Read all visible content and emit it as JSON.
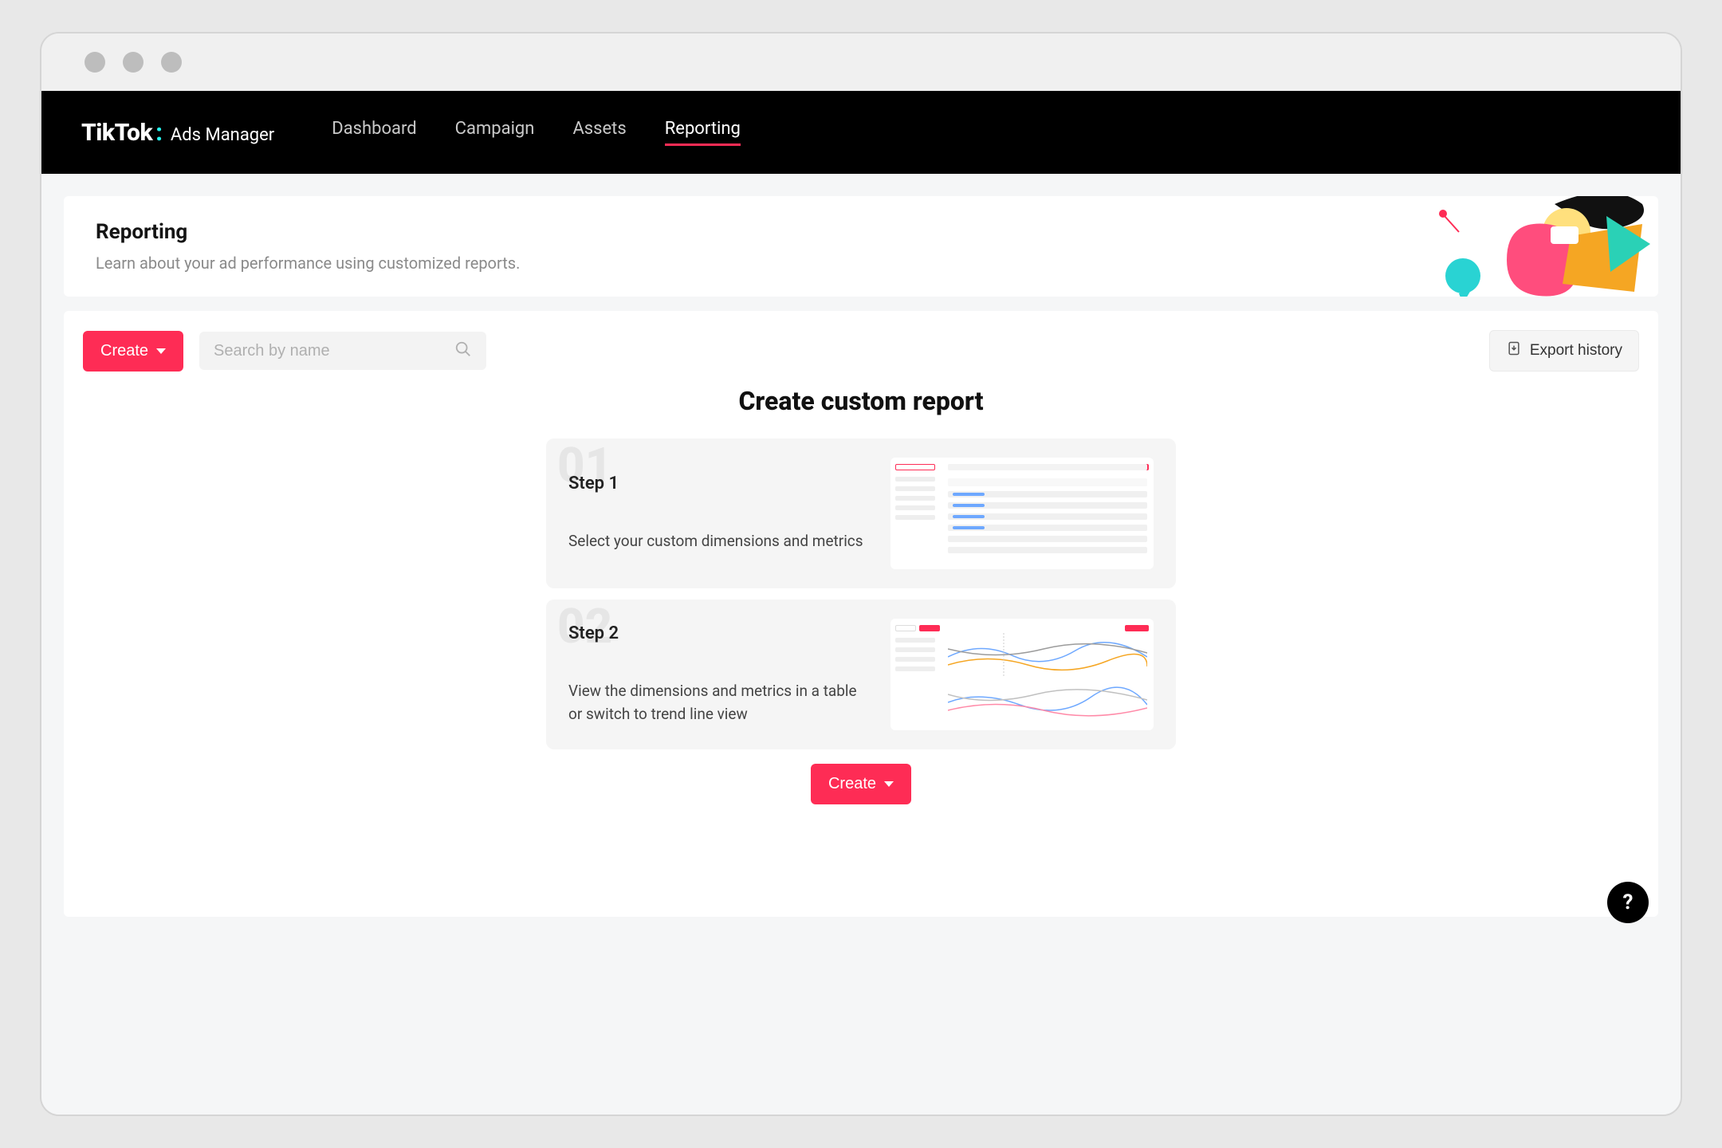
{
  "brand": {
    "name": "TikTok",
    "sub": "Ads Manager"
  },
  "nav": {
    "items": [
      "Dashboard",
      "Campaign",
      "Assets",
      "Reporting"
    ],
    "active_index": 3
  },
  "hero": {
    "title": "Reporting",
    "subtitle": "Learn about your ad performance using customized reports."
  },
  "toolbar": {
    "create_label": "Create",
    "search_placeholder": "Search by name",
    "export_label": "Export history"
  },
  "section": {
    "title": "Create custom report",
    "steps": [
      {
        "bgnum": "01",
        "title": "Step 1",
        "desc": "Select your custom dimensions and metrics"
      },
      {
        "bgnum": "02",
        "title": "Step 2",
        "desc": "View the dimensions and metrics in a table or switch to trend line view"
      }
    ],
    "create_button": "Create"
  },
  "icons": {
    "search": "search-icon",
    "export": "file-export-icon",
    "chevron_down": "chevron-down-icon",
    "help": "?"
  }
}
